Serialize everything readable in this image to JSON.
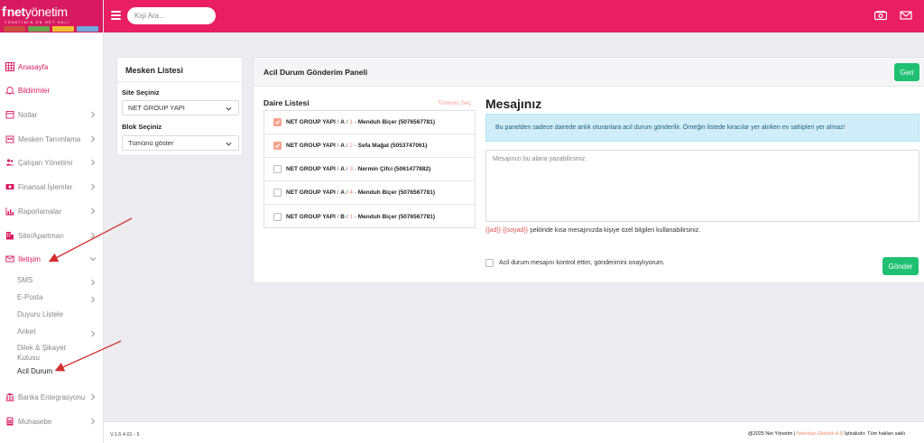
{
  "brand": {
    "logo_f": "f",
    "logo_net": "net",
    "logo_yonetim": " yönetim",
    "tagline": "YÖNETİMİN EN NET HALİ",
    "tile_colors": [
      "#c94f3d",
      "#6aa84f",
      "#f1c232",
      "#6fa8dc"
    ]
  },
  "colors": {
    "primary": "#e91e63",
    "accent": "#20c073",
    "checkbox": "#f4a28a"
  },
  "topbar": {
    "search_placeholder": "Kişi Ara...",
    "icons": [
      "money-icon",
      "mail-icon"
    ]
  },
  "sidebar": {
    "items": [
      {
        "label": "Anasayfa",
        "icon": "grid-icon",
        "style": "red",
        "chevron": false
      },
      {
        "label": "Bildirimler",
        "icon": "bell-icon",
        "style": "red",
        "chevron": false
      },
      {
        "label": "Notlar",
        "icon": "calendar-icon",
        "style": "gray",
        "chevron": true
      },
      {
        "label": "Mesken Tanımlama",
        "icon": "building-icon",
        "style": "gray",
        "chevron": true
      },
      {
        "label": "Çalışan Yönetimi",
        "icon": "users-icon",
        "style": "gray",
        "chevron": true
      },
      {
        "label": "Finansal İşlemler",
        "icon": "money-icon",
        "style": "gray",
        "chevron": true
      },
      {
        "label": "Raporlamalar",
        "icon": "chart-icon",
        "style": "gray",
        "chevron": true
      },
      {
        "label": "Site/Apartman",
        "icon": "apartment-icon",
        "style": "gray",
        "chevron": true
      },
      {
        "label": "İletişim",
        "icon": "envelope-icon",
        "style": "red",
        "chevron": "down"
      }
    ],
    "subitems": [
      {
        "label": "SMS",
        "chevron": true
      },
      {
        "label": "E-Posta",
        "chevron": true
      },
      {
        "label": "Duyuru Listele",
        "chevron": false
      },
      {
        "label": "Anket",
        "chevron": true
      },
      {
        "label": "Dilek & Şikayet Kutusu",
        "chevron": false
      },
      {
        "label": "Acil Durum",
        "chevron": false,
        "active": true
      }
    ],
    "bottom_items": [
      {
        "label": "Banka Entegrasyonu",
        "icon": "bank-icon",
        "chevron": true
      },
      {
        "label": "Muhasebe",
        "icon": "calculator-icon",
        "chevron": true
      }
    ]
  },
  "mesken": {
    "title": "Mesken Listesi",
    "site_label": "Site Seçiniz",
    "site_value": "NET GROUP YAPI",
    "blok_label": "Blok Seçiniz",
    "blok_value": "Tümünü göster"
  },
  "panel": {
    "title": "Acil Durum Gönderim Paneli",
    "back_label": "Geri",
    "list_title": "Daire Listesi",
    "select_all": "Tümünü Seç",
    "rows": [
      {
        "site": "NET GROUP YAPI",
        "block": "A",
        "no": "1",
        "resident": "Menduh Biçer (5076567781)",
        "checked": true
      },
      {
        "site": "NET GROUP YAPI",
        "block": "A",
        "no": "2",
        "resident": "Sefa Mağat (5053747061)",
        "checked": true
      },
      {
        "site": "NET GROUP YAPI",
        "block": "A",
        "no": "3",
        "resident": "Nermin Çifci (5061477882)",
        "checked": false
      },
      {
        "site": "NET GROUP YAPI",
        "block": "A",
        "no": "4",
        "resident": "Menduh Biçer (5076567781)",
        "checked": false
      },
      {
        "site": "NET GROUP YAPI",
        "block": "B",
        "no": "1",
        "resident": "Menduh Biçer (5076567781)",
        "checked": false
      }
    ],
    "message_title": "Mesajınız",
    "info": "Bu panelden sadece dairede anlık oturanlara acil durum gönderilir. Örneğin listede kiracılar yer alırken ev sahipleri yer almaz!",
    "message_placeholder": "Mesajınızı bu alana yazabilirsiniz.",
    "hint_var1": "{{ad}}",
    "hint_var2": "{{soyad}}",
    "hint_rest": "şeklinde kısa mesajınızda kişiye özel bilgileri kullanabilirsiniz.",
    "confirm_label": "Acil durum mesajını kontrol ettim, gönderimini onaylıyorum.",
    "send_label": "Gönder"
  },
  "footer": {
    "version": "V.1.6.4.01 - 5",
    "copyright_pre": "@2025 Net Yönetim | ",
    "company": "Netelsan Elektrik A.Ş",
    "copyright_post": " İştirakıdır. Tüm hakları saklı"
  }
}
